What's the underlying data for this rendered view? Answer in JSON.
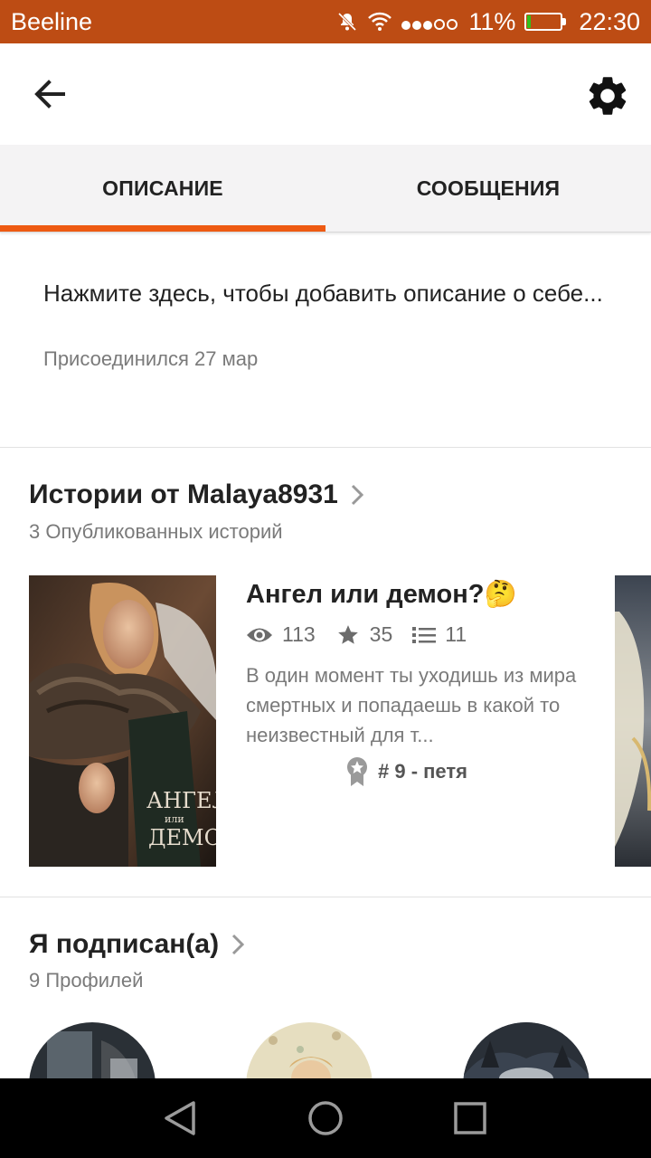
{
  "status_bar": {
    "carrier": "Beeline",
    "battery_percent": "11%",
    "battery_level": 0.11,
    "time": "22:30",
    "icons": [
      "notifications-muted-icon",
      "wifi-icon",
      "signal-icon",
      "battery-icon"
    ]
  },
  "app_bar": {
    "icons": [
      "back-arrow-icon",
      "gear-icon"
    ]
  },
  "tabs": [
    {
      "label": "ОПИСАНИЕ",
      "active": true
    },
    {
      "label": "СООБЩЕНИЯ",
      "active": false
    }
  ],
  "about": {
    "description_placeholder": "Нажмите здесь, чтобы добавить описание о себе...",
    "joined": "Присоединился 27 мар"
  },
  "stories_section": {
    "title": "Истории от Malaya8931",
    "subtitle": "3 Опубликованных историй",
    "stories": [
      {
        "title": "Ангел или демон?🤔",
        "reads": "113",
        "votes": "35",
        "parts": "11",
        "description": "В один момент ты уходишь из мира смертных и попадаешь в какой то неизвестный для т...",
        "rank": "# 9 - петя",
        "cover_text_line1": "АНГЕЛ",
        "cover_text_line2": "или",
        "cover_text_line3": "ДЕМОН"
      }
    ]
  },
  "following_section": {
    "title": "Я подписан(а)",
    "subtitle": "9 Профилей"
  },
  "colors": {
    "status_bar": "#bd4c14",
    "accent": "#ee5a12",
    "tab_bg": "#f4f3f4"
  }
}
